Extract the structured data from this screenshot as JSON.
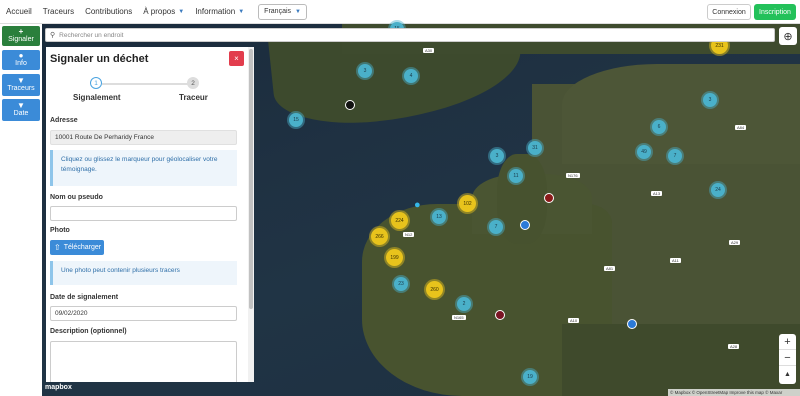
{
  "nav": {
    "links": [
      "Accueil",
      "Traceurs",
      "Contributions",
      "À propos",
      "Information"
    ],
    "language": "Français",
    "login": "Connexion",
    "signup": "Inscription"
  },
  "side": {
    "report": "Signaler",
    "info": "Info",
    "tracers": "Traceurs",
    "date": "Date"
  },
  "search": {
    "placeholder": "Rechercher un endroit"
  },
  "panel": {
    "title": "Signaler un déchet",
    "close": "×",
    "step1_num": "1",
    "step1_label": "Signalement",
    "step2_num": "2",
    "step2_label": "Traceur",
    "address_label": "Adresse",
    "address_value": "10001 Route De Perharidy France",
    "address_info": "Cliquez ou glissez le marqueur pour géolocaliser votre témoignage.",
    "name_label": "Nom ou pseudo",
    "photo_label": "Photo",
    "upload_label": "Télécharger",
    "photo_info": "Une photo peut contenir plusieurs tracers",
    "date_label": "Date de signalement",
    "date_value": "09/02/2020",
    "desc_label": "Description (optionnel)"
  },
  "map": {
    "clusters_teal": [
      "15",
      "3",
      "4",
      "15",
      "3",
      "6",
      "31",
      "3",
      "49",
      "7",
      "11",
      "24",
      "13",
      "7",
      "23",
      "2",
      "19",
      "10",
      "4",
      "4"
    ],
    "clusters_yellow": [
      "231",
      "102",
      "224",
      "266",
      "199",
      "260"
    ],
    "roads": [
      "A30",
      "A38",
      "A84",
      "A13",
      "A29",
      "A28",
      "A11",
      "A81",
      "A10",
      "A82",
      "A83",
      "A84",
      "N176",
      "N12",
      "N165"
    ],
    "zoom_in": "+",
    "zoom_out": "−",
    "compass": "▲",
    "logo": "mapbox",
    "attribution": "© Mapbox © OpenStreetMap Improve this map © Maxar"
  }
}
